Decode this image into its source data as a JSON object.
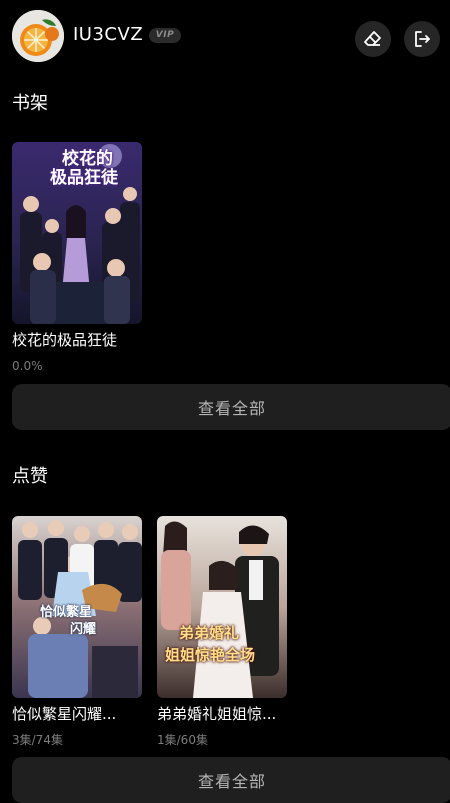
{
  "header": {
    "username": "IU3CVZ",
    "vip_label": "VIP",
    "avatar_icon": "orange-slice-avatar",
    "clear_icon": "eraser-icon",
    "logout_icon": "logout-icon"
  },
  "shelf": {
    "title": "书架",
    "books": [
      {
        "title": "校花的极品狂徒",
        "progress": "0.0%",
        "cover_text": [
          "校花的",
          "极品狂徒"
        ]
      }
    ],
    "view_all_label": "查看全部"
  },
  "likes": {
    "title": "点赞",
    "books": [
      {
        "title": "恰似繁星闪耀...",
        "progress": "3集/74集",
        "cover_text": [
          "恰似繁星",
          "闪耀"
        ]
      },
      {
        "title": "弟弟婚礼姐姐惊...",
        "progress": "1集/60集",
        "cover_text": [
          "弟弟婚礼",
          "姐姐惊艳全场"
        ]
      }
    ],
    "view_all_label": "查看全部"
  },
  "colors": {
    "background": "#000000",
    "button_bg": "#1f1f1f",
    "muted_text": "#7d7d7d"
  }
}
